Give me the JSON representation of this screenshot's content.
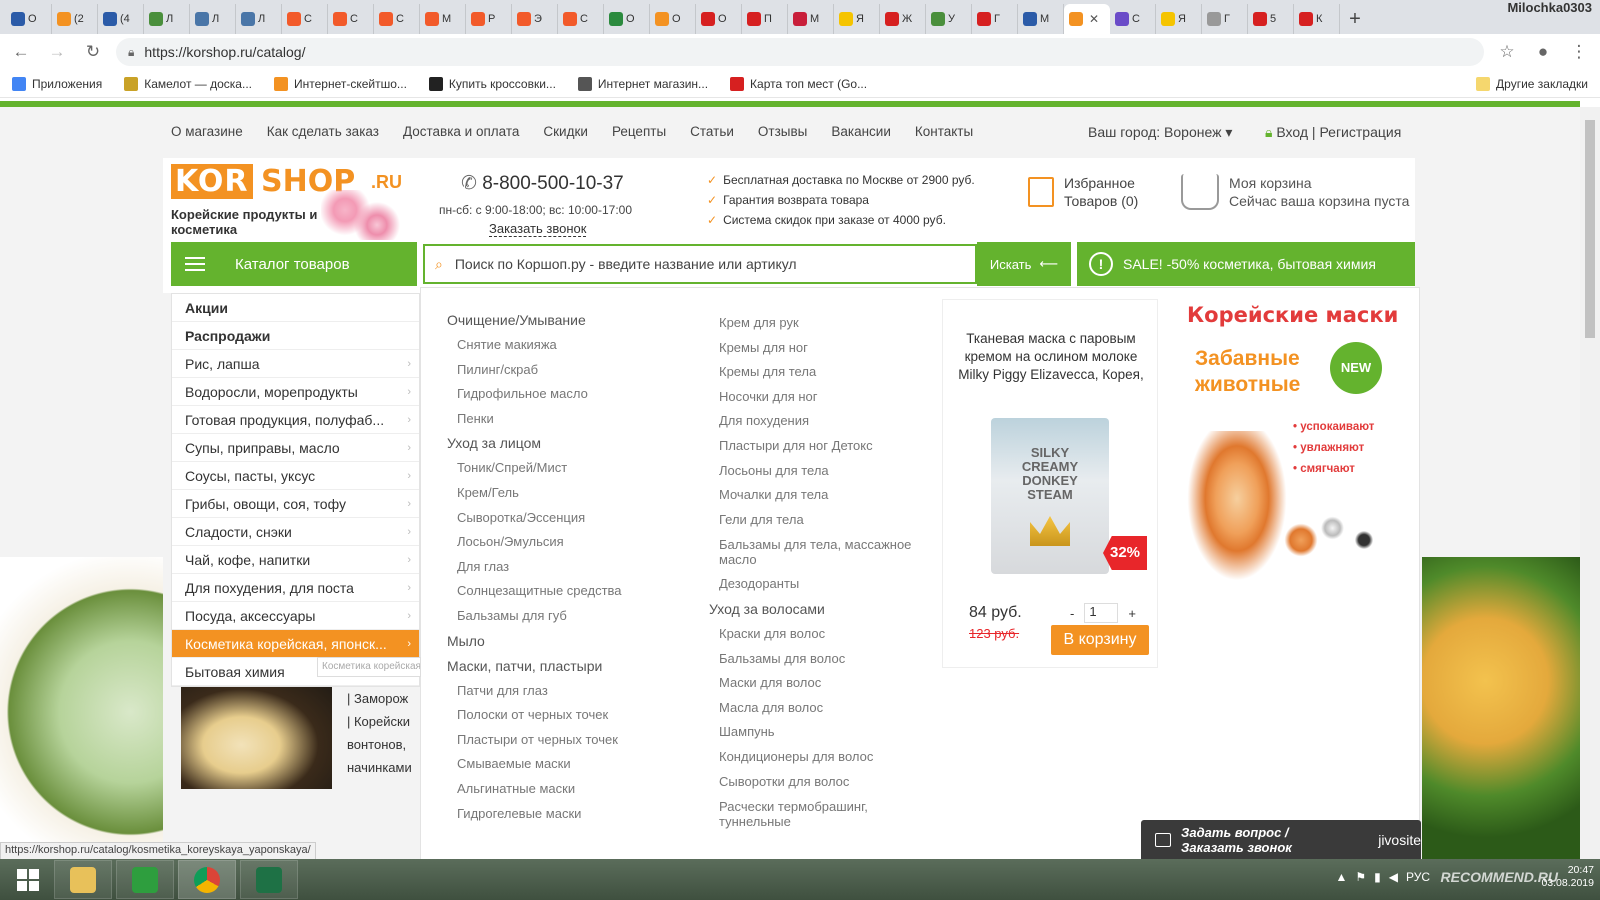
{
  "browser": {
    "tabs": [
      {
        "label": "О",
        "color": "#2b5ba8"
      },
      {
        "label": "(2",
        "color": "#f39222"
      },
      {
        "label": "(4",
        "color": "#2b5ba8"
      },
      {
        "label": "Л",
        "color": "#4a8f3c"
      },
      {
        "label": "Л",
        "color": "#4a76a8"
      },
      {
        "label": "Л",
        "color": "#4a76a8"
      },
      {
        "label": "С",
        "color": "#f25a2a"
      },
      {
        "label": "С",
        "color": "#f25a2a"
      },
      {
        "label": "С",
        "color": "#f25a2a"
      },
      {
        "label": "М",
        "color": "#f25a2a"
      },
      {
        "label": "Р",
        "color": "#f25a2a"
      },
      {
        "label": "Э",
        "color": "#f25a2a"
      },
      {
        "label": "С",
        "color": "#f25a2a"
      },
      {
        "label": "О",
        "color": "#2b8a3e"
      },
      {
        "label": "О",
        "color": "#f39222"
      },
      {
        "label": "О",
        "color": "#d62020"
      },
      {
        "label": "П",
        "color": "#d62020"
      },
      {
        "label": "М",
        "color": "#c81e3a"
      },
      {
        "label": "Я",
        "color": "#f5c400"
      },
      {
        "label": "Ж",
        "color": "#d62020"
      },
      {
        "label": "У",
        "color": "#4a8f3c"
      },
      {
        "label": "Г",
        "color": "#d62020"
      },
      {
        "label": "М",
        "color": "#2b5ba8"
      },
      {
        "label": "",
        "color": "#f39222",
        "active": true
      },
      {
        "label": "С",
        "color": "#6a4bc8"
      },
      {
        "label": "Я",
        "color": "#f5c400"
      },
      {
        "label": "Г",
        "color": "#999999"
      },
      {
        "label": "5",
        "color": "#d62020"
      },
      {
        "label": "К",
        "color": "#d62020"
      }
    ],
    "profile_name": "Milochka0303",
    "url": "https://korshop.ru/catalog/",
    "bookmarks": [
      {
        "label": "Приложения",
        "color": "#4285f4"
      },
      {
        "label": "Камелот — доска...",
        "color": "#c9a227"
      },
      {
        "label": "Интернет-скейтшо...",
        "color": "#f39222"
      },
      {
        "label": "Купить кроссовки...",
        "color": "#222222"
      },
      {
        "label": "Интернет магазин...",
        "color": "#555555"
      },
      {
        "label": "Карта топ мест (Go...",
        "color": "#d62020"
      }
    ],
    "other_bookmarks": "Другие закладки",
    "status_url": "https://korshop.ru/catalog/kosmetika_koreyskaya_yaponskaya/"
  },
  "site": {
    "topnav": [
      "О магазине",
      "Как сделать заказ",
      "Доставка и оплата",
      "Скидки",
      "Рецепты",
      "Статьи",
      "Отзывы",
      "Вакансии",
      "Контакты"
    ],
    "city": "Ваш город: Воронеж",
    "login": "Вход",
    "register": "Регистрация",
    "logo_left": "KOR",
    "logo_right": "SHOP",
    "logo_tld": ".RU",
    "tagline": "Корейские продукты и косметика",
    "phone": "8-800-500-10-37",
    "hours": "пн-сб: с 9:00-18:00; вс: 10:00-17:00",
    "callback": "Заказать звонок",
    "benefits": [
      "Бесплатная доставка по Москве от 2900 руб.",
      "Гарантия возврата товара",
      "Система скидок при заказе от 4000 руб."
    ],
    "favorites_title": "Избранное",
    "favorites_count": "Товаров (0)",
    "cart_title": "Моя корзина",
    "cart_status": "Сейчас ваша корзина пуста",
    "catalog_button": "Каталог товаров",
    "search_placeholder": "Поиск по Коршоп.ру - введите название или артикул",
    "search_button": "Искать",
    "sale_text": "SALE! -50% косметика, бытовая химия",
    "categories": [
      {
        "label": "Акции",
        "bold": true
      },
      {
        "label": "Распродажи",
        "bold": true
      },
      {
        "label": "Рис, лапша"
      },
      {
        "label": "Водоросли, морепродукты"
      },
      {
        "label": "Готовая продукция, полуфаб..."
      },
      {
        "label": "Супы, приправы, масло"
      },
      {
        "label": "Соусы, пасты, уксус"
      },
      {
        "label": "Грибы, овощи, соя, тофу"
      },
      {
        "label": "Сладости, снэки"
      },
      {
        "label": "Чай, кофе, напитки"
      },
      {
        "label": "Для похудения, для поста"
      },
      {
        "label": "Посуда, аксессуары"
      },
      {
        "label": "Косметика корейская, японск...",
        "active": true
      },
      {
        "label": "Бытовая химия"
      }
    ],
    "tooltip": "Косметика корейская, японская",
    "teasers": [
      "| Заморож",
      "| Корейски",
      "вонтонов,",
      "начинками"
    ],
    "submenu": {
      "col1": [
        {
          "type": "hd",
          "label": "Очищение/Умывание"
        },
        {
          "type": "it",
          "label": "Снятие макияжа"
        },
        {
          "type": "it",
          "label": "Пилинг/скраб"
        },
        {
          "type": "it",
          "label": "Гидрофильное масло"
        },
        {
          "type": "it",
          "label": "Пенки"
        },
        {
          "type": "hd",
          "label": "Уход за лицом"
        },
        {
          "type": "it",
          "label": "Тоник/Спрей/Мист"
        },
        {
          "type": "it",
          "label": "Крем/Гель"
        },
        {
          "type": "it",
          "label": "Сыворотка/Эссенция"
        },
        {
          "type": "it",
          "label": "Лосьон/Эмульсия"
        },
        {
          "type": "it",
          "label": "Для глаз"
        },
        {
          "type": "it",
          "label": "Солнцезащитные средства"
        },
        {
          "type": "it",
          "label": "Бальзамы для губ"
        },
        {
          "type": "hd",
          "label": "Мыло"
        },
        {
          "type": "hd",
          "label": "Маски, патчи, пластыри"
        },
        {
          "type": "it",
          "label": "Патчи для глаз"
        },
        {
          "type": "it",
          "label": "Полоски от черных точек"
        },
        {
          "type": "it",
          "label": "Пластыри от черных точек"
        },
        {
          "type": "it",
          "label": "Смываемые маски"
        },
        {
          "type": "it",
          "label": "Альгинатные маски"
        },
        {
          "type": "it",
          "label": "Гидрогелевые маски"
        }
      ],
      "col2": [
        {
          "type": "it",
          "label": "Крем для рук"
        },
        {
          "type": "it",
          "label": "Кремы для ног"
        },
        {
          "type": "it",
          "label": "Кремы для тела"
        },
        {
          "type": "it",
          "label": "Носочки для ног"
        },
        {
          "type": "it",
          "label": "Для похудения"
        },
        {
          "type": "it",
          "label": "Пластыри для ног Детокс"
        },
        {
          "type": "it",
          "label": "Лосьоны для тела"
        },
        {
          "type": "it",
          "label": "Мочалки для тела"
        },
        {
          "type": "it",
          "label": "Гели для тела"
        },
        {
          "type": "it2",
          "label": "Бальзамы для тела, массажное масло"
        },
        {
          "type": "it",
          "label": "Дезодоранты"
        },
        {
          "type": "hd",
          "label": "Уход за волосами"
        },
        {
          "type": "it",
          "label": "Краски для волос"
        },
        {
          "type": "it",
          "label": "Бальзамы для волос"
        },
        {
          "type": "it",
          "label": "Маски для волос"
        },
        {
          "type": "it",
          "label": "Масла для волос"
        },
        {
          "type": "it",
          "label": "Шампунь"
        },
        {
          "type": "it",
          "label": "Кондиционеры для волос"
        },
        {
          "type": "it",
          "label": "Сыворотки для волос"
        },
        {
          "type": "it2",
          "label": "Расчески термобрашинг, туннельные"
        }
      ]
    },
    "product": {
      "title": "Тканевая маска с паровым кремом на ослином молоке Milky Piggy Elizavecca, Корея,",
      "image_text": "SILKY CREAMY DONKEY STEAM",
      "discount": "32%",
      "price": "84 руб.",
      "old_price": "123 руб.",
      "qty_minus": "-",
      "qty": "1",
      "qty_plus": "+",
      "buy": "В корзину"
    },
    "banner": {
      "title": "Корейские маски",
      "subtitle": "Забавные животные",
      "new_badge": "NEW",
      "bullets": [
        "• успокаивают",
        "• увлажняют",
        "• смягчают"
      ]
    },
    "chat": {
      "label": "Задать вопрос / Заказать звонок",
      "brand": "jivosite"
    }
  },
  "taskbar": {
    "time": "20:47",
    "date": "03.08.2019",
    "watermark": "RECOMMEND.RU",
    "lang": "РУС"
  },
  "colors": {
    "green": "#64b32e",
    "orange": "#f39222",
    "red": "#e8262a"
  }
}
